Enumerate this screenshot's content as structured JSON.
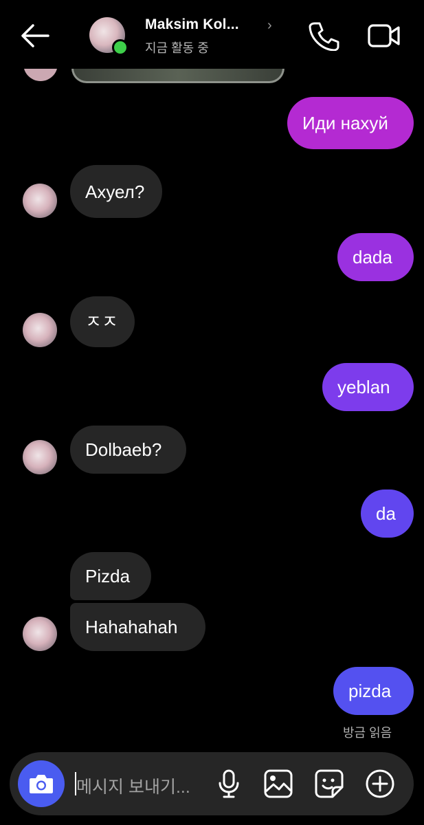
{
  "header": {
    "name": "Maksim Kol...",
    "status": "지금 활동 중",
    "chevron": "›"
  },
  "messages": [
    {
      "id": "m1",
      "side": "out",
      "text": "Иди нахуй",
      "color": "#b42ad2"
    },
    {
      "id": "m2",
      "side": "in",
      "text": "Ахуел?"
    },
    {
      "id": "m3",
      "side": "out",
      "text": "dada",
      "color": "#9a31e0"
    },
    {
      "id": "m4",
      "side": "in",
      "text": "ㅈㅈ"
    },
    {
      "id": "m5",
      "side": "out",
      "text": "yeblan",
      "color": "#7d3cec"
    },
    {
      "id": "m6",
      "side": "in",
      "text": "Dolbaeb?"
    },
    {
      "id": "m7",
      "side": "out",
      "text": "da",
      "color": "#6146ef"
    },
    {
      "id": "m8",
      "side": "in",
      "text": "Pizda"
    },
    {
      "id": "m9",
      "side": "in",
      "text": "Hahahahah"
    },
    {
      "id": "m10",
      "side": "out",
      "text": "pizda",
      "color": "#5451f0"
    }
  ],
  "read_receipt": "방금 읽음",
  "composer": {
    "placeholder": "메시지 보내기...",
    "icons": [
      "camera-icon",
      "microphone-icon",
      "gallery-icon",
      "sticker-icon",
      "plus-circle-icon"
    ],
    "camera_color": "#4a5cf0"
  }
}
